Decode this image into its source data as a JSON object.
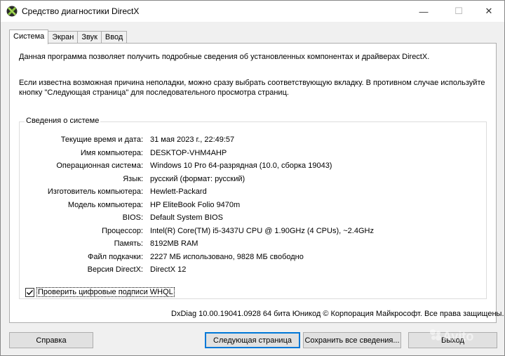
{
  "window": {
    "title": "Средство диагностики DirectX",
    "icon": "directx-icon",
    "controls": {
      "minimize": "—",
      "maximize": "☐",
      "close": "✕"
    }
  },
  "tabs": [
    {
      "label": "Система",
      "active": true
    },
    {
      "label": "Экран",
      "active": false
    },
    {
      "label": "Звук",
      "active": false
    },
    {
      "label": "Ввод",
      "active": false
    }
  ],
  "panel": {
    "intro": "Данная программа позволяет получить подробные сведения об установленных компонентах и драйверах DirectX.",
    "hint": "Если известна возможная причина неполадки, можно сразу выбрать соответствующую вкладку. В противном случае используйте кнопку \"Следующая страница\" для последовательного просмотра страниц.",
    "group_label": "Сведения о системе",
    "rows": [
      {
        "label": "Текущие время и дата:",
        "value": "31 мая 2023 г., 22:49:57"
      },
      {
        "label": "Имя компьютера:",
        "value": "DESKTOP-VHM4AHP"
      },
      {
        "label": "Операционная система:",
        "value": "Windows 10 Pro 64-разрядная (10.0, сборка 19043)"
      },
      {
        "label": "Язык:",
        "value": "русский (формат: русский)"
      },
      {
        "label": "Изготовитель компьютера:",
        "value": "Hewlett-Packard"
      },
      {
        "label": "Модель компьютера:",
        "value": "HP EliteBook Folio 9470m"
      },
      {
        "label": "BIOS:",
        "value": "Default System BIOS"
      },
      {
        "label": "Процессор:",
        "value": "Intel(R) Core(TM) i5-3437U CPU @ 1.90GHz (4 CPUs), ~2.4GHz"
      },
      {
        "label": "Память:",
        "value": "8192MB RAM"
      },
      {
        "label": "Файл подкачки:",
        "value": "2227 МБ использовано, 9828 МБ свободно"
      },
      {
        "label": "Версия DirectX:",
        "value": "DirectX 12"
      }
    ],
    "whql_checkbox": {
      "label": "Проверить цифровые подписи WHQL",
      "checked": true
    },
    "footer": "DxDiag 10.00.19041.0928 64 бита Юникод  © Корпорация Майкрософт. Все права защищены."
  },
  "buttons": {
    "help": "Справка",
    "next_page": "Следующая страница",
    "save_all": "Сохранить все сведения...",
    "exit": "Выход"
  },
  "watermark": {
    "text": "Avito"
  },
  "colors": {
    "focus": "#0078d7",
    "directx_icon": "#7cb82f"
  }
}
